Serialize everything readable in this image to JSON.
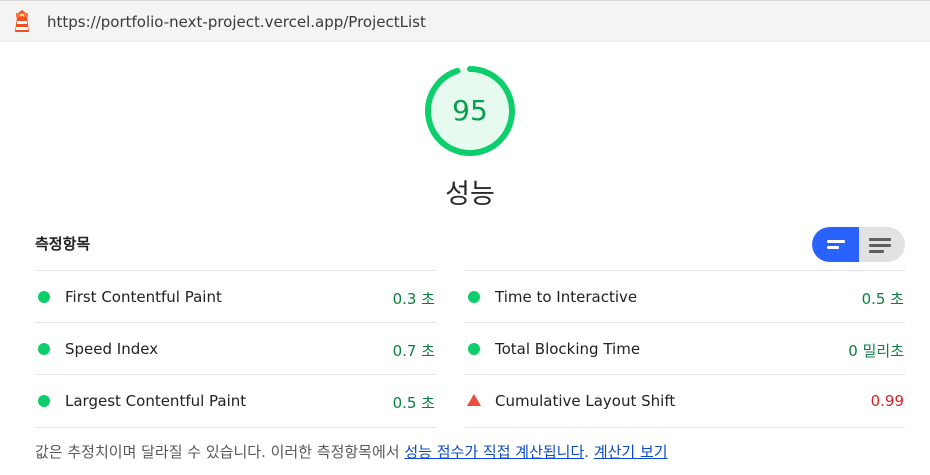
{
  "header": {
    "url": "https://portfolio-next-project.vercel.app/ProjectList"
  },
  "gauge": {
    "score": "95",
    "score_fraction": 0.95,
    "label": "성능",
    "color": "#0cce6b"
  },
  "metrics": {
    "title": "측정항목",
    "toggle": {
      "active": "compact",
      "active_color": "#2962ff",
      "options": [
        "compact-view-icon",
        "expanded-view-icon"
      ]
    },
    "items": [
      {
        "name": "First Contentful Paint",
        "value": "0.3 초",
        "status": "pass"
      },
      {
        "name": "Time to Interactive",
        "value": "0.5 초",
        "status": "pass"
      },
      {
        "name": "Speed Index",
        "value": "0.7 초",
        "status": "pass"
      },
      {
        "name": "Total Blocking Time",
        "value": "0 밀리초",
        "status": "pass"
      },
      {
        "name": "Largest Contentful Paint",
        "value": "0.5 초",
        "status": "pass"
      },
      {
        "name": "Cumulative Layout Shift",
        "value": "0.99",
        "status": "fail"
      }
    ],
    "status_colors": {
      "pass": "#0cce6b",
      "fail": "#eb4c3d"
    }
  },
  "footer_note": {
    "text": "값은 추정치이며 달라질 수 있습니다. 이러한 측정항목에서 ",
    "link1": "성능 점수가 직접 계산됩니다",
    "separator": ". ",
    "link2": "계산기 보기"
  }
}
